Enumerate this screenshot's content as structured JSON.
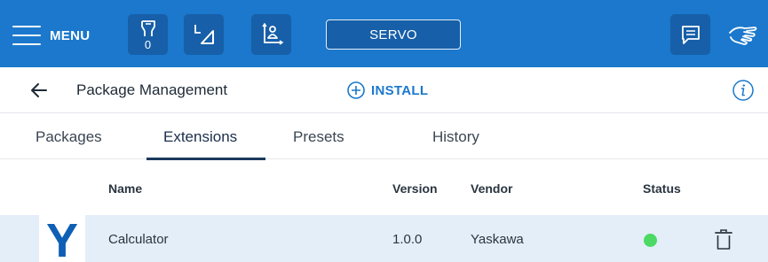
{
  "colors": {
    "topbar": "#1b78cc",
    "topbar_icon_bg": "#175fa8",
    "accent": "#1b78cc",
    "status_ok": "#4cd964",
    "row_selected": "#e4eef9",
    "vendor_logo": "#0e5fb5"
  },
  "topbar": {
    "menu_label": "MENU",
    "menu_icon": "hamburger-icon",
    "tool_counter": "0",
    "tool_icon": "robot-tool-icon",
    "frame_icon": "coordinate-frame-icon",
    "user_frame_icon": "user-frame-icon",
    "servo_label": "SERVO",
    "chat_icon": "chat-icon",
    "gesture_icon": "hand-gesture-icon"
  },
  "header": {
    "title": "Package Management",
    "install_label": "INSTALL",
    "back_icon": "back-arrow-icon",
    "install_icon": "plus-circle-icon",
    "info_icon": "info-icon"
  },
  "tabs": [
    {
      "label": "Packages",
      "active": false
    },
    {
      "label": "Extensions",
      "active": true
    },
    {
      "label": "Presets",
      "active": false
    },
    {
      "label": "History",
      "active": false
    }
  ],
  "table": {
    "columns": [
      "Name",
      "Version",
      "Vendor",
      "Status"
    ],
    "rows": [
      {
        "logo_letter": "Y",
        "name": "Calculator",
        "version": "1.0.0",
        "vendor": "Yaskawa",
        "status": "running",
        "action_icon": "trash-icon"
      }
    ]
  }
}
